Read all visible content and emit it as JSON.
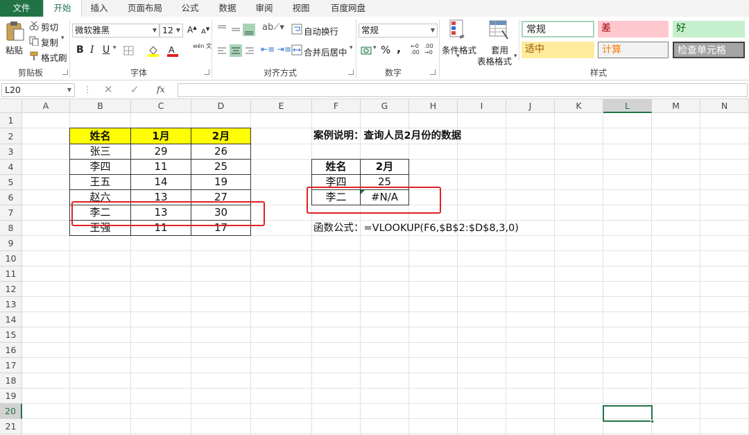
{
  "ribbon": {
    "tabs": [
      "文件",
      "开始",
      "插入",
      "页面布局",
      "公式",
      "数据",
      "审阅",
      "视图",
      "百度网盘"
    ],
    "clipboard": {
      "paste": "粘贴",
      "cut": "剪切",
      "copy": "复制",
      "format_painter": "格式刷",
      "label": "剪贴板"
    },
    "font": {
      "name": "微软雅黑",
      "size": "12",
      "label": "字体",
      "bold": "B",
      "italic": "I",
      "underline": "U",
      "color_letter": "A",
      "phonetic": "wén 文"
    },
    "alignment": {
      "wrap": "自动换行",
      "merge": "合并后居中",
      "label": "对齐方式"
    },
    "number": {
      "format": "常规",
      "percent": "%",
      "comma": ",",
      "label": "数字"
    },
    "styles": {
      "conditional": "条件格式",
      "table_format_1": "套用",
      "table_format_2": "表格格式",
      "cells": [
        "常规",
        "差",
        "好",
        "适中",
        "计算",
        "检查单元格"
      ],
      "label": "样式"
    }
  },
  "formula_bar": {
    "name_box": "L20",
    "fx": "fx",
    "value": ""
  },
  "sheet": {
    "columns": [
      "A",
      "B",
      "C",
      "D",
      "E",
      "F",
      "G",
      "H",
      "I",
      "J",
      "K",
      "L",
      "M",
      "N"
    ],
    "rows": [
      "1",
      "2",
      "3",
      "4",
      "5",
      "6",
      "7",
      "8",
      "9",
      "10",
      "11",
      "12",
      "13",
      "14",
      "15",
      "16",
      "17",
      "18",
      "19",
      "20",
      "21"
    ],
    "selected_cell": "L20",
    "table1": {
      "headers": [
        "姓名",
        "1月",
        "2月"
      ],
      "rows": [
        [
          "张三",
          "29",
          "26"
        ],
        [
          "李四",
          "11",
          "25"
        ],
        [
          "王五",
          "14",
          "19"
        ],
        [
          "赵六",
          "13",
          "27"
        ],
        [
          "李二",
          "13",
          "30"
        ],
        [
          "王强",
          "11",
          "17"
        ]
      ]
    },
    "case_title": "案例说明：查询人员2月份的数据",
    "table2": {
      "headers": [
        "姓名",
        "2月"
      ],
      "rows": [
        [
          "李四",
          "25"
        ],
        [
          "李二",
          "#N/A"
        ]
      ]
    },
    "formula_text": "函数公式：=VLOOKUP(F6,$B$2:$D$8,3,0)"
  },
  "colors": {
    "excel_green": "#217346",
    "header_yellow": "#ffff00",
    "highlight_red": "#e02020"
  }
}
